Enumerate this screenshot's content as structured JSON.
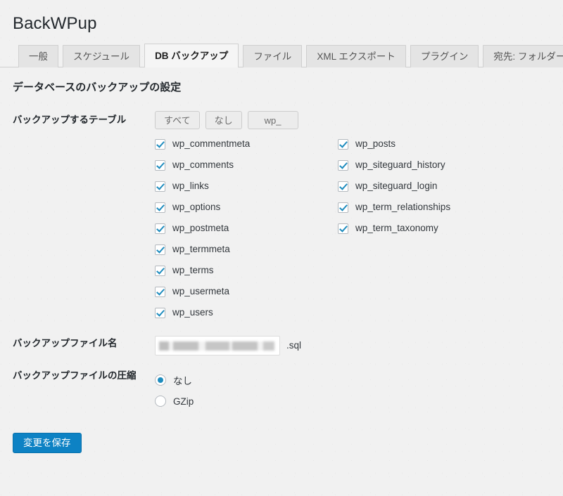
{
  "header": {
    "title": "BackWPup"
  },
  "tabs": [
    {
      "label": "一般",
      "active": false
    },
    {
      "label": "スケジュール",
      "active": false
    },
    {
      "label": "DB バックアップ",
      "active": true
    },
    {
      "label": "ファイル",
      "active": false
    },
    {
      "label": "XML エクスポート",
      "active": false
    },
    {
      "label": "プラグイン",
      "active": false
    },
    {
      "label": "宛先: フォルダー",
      "active": false
    }
  ],
  "section": {
    "heading": "データベースのバックアップの設定"
  },
  "tables_field": {
    "label": "バックアップするテーブル",
    "buttons": [
      {
        "label": "すべて"
      },
      {
        "label": "なし"
      },
      {
        "label": "wp_"
      }
    ],
    "column_left": [
      {
        "label": "wp_commentmeta",
        "checked": true
      },
      {
        "label": "wp_comments",
        "checked": true
      },
      {
        "label": "wp_links",
        "checked": true
      },
      {
        "label": "wp_options",
        "checked": true
      },
      {
        "label": "wp_postmeta",
        "checked": true
      },
      {
        "label": "wp_termmeta",
        "checked": true
      },
      {
        "label": "wp_terms",
        "checked": true
      },
      {
        "label": "wp_usermeta",
        "checked": true
      },
      {
        "label": "wp_users",
        "checked": true
      }
    ],
    "column_right": [
      {
        "label": "wp_posts",
        "checked": true
      },
      {
        "label": "wp_siteguard_history",
        "checked": true
      },
      {
        "label": "wp_siteguard_login",
        "checked": true
      },
      {
        "label": "wp_term_relationships",
        "checked": true
      },
      {
        "label": "wp_term_taxonomy",
        "checked": true
      }
    ]
  },
  "filename_field": {
    "label": "バックアップファイル名",
    "value": "",
    "placeholder": "",
    "suffix": ".sql"
  },
  "compression_field": {
    "label": "バックアップファイルの圧縮",
    "options": [
      {
        "label": "なし",
        "selected": true
      },
      {
        "label": "GZip",
        "selected": false
      }
    ]
  },
  "submit": {
    "label": "変更を保存"
  },
  "colors": {
    "background": "#f1f1f1",
    "accent": "#1e8cbe",
    "primary_button": "#0d82c4",
    "text": "#32373c",
    "tab_inactive": "#e4e4e4",
    "tab_active": "#f5f5f5"
  }
}
